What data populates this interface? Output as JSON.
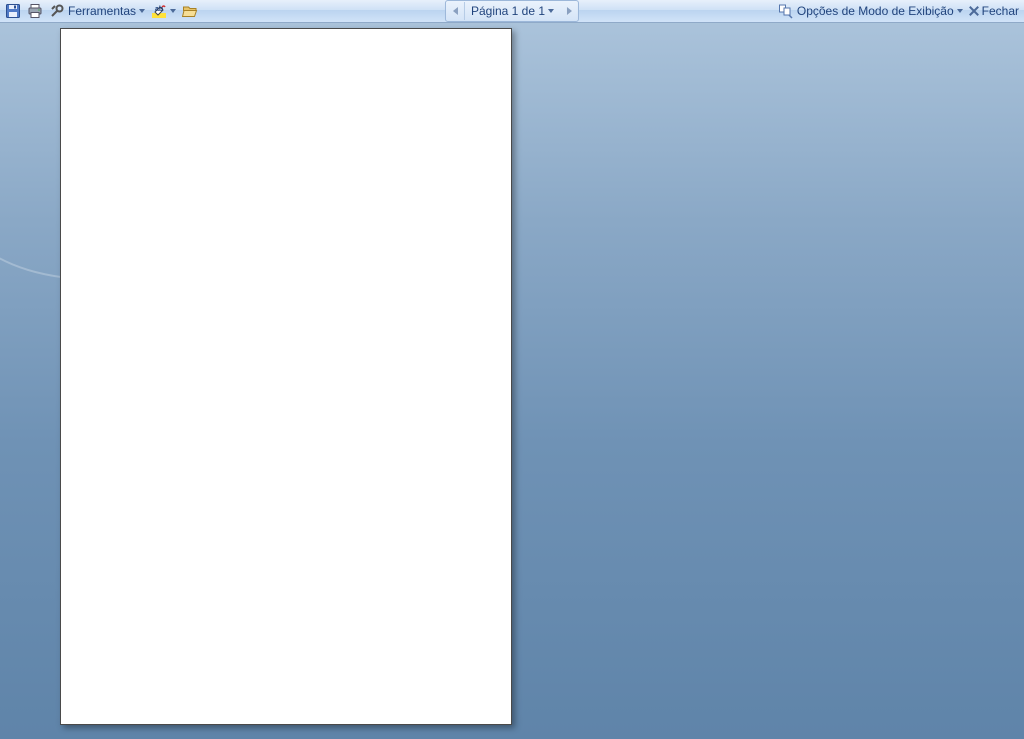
{
  "toolbar": {
    "left": {
      "tools_label": "Ferramentas"
    },
    "center": {
      "page_label": "Página 1 de 1"
    },
    "right": {
      "view_options_label": "Opções de Modo de Exibição",
      "close_label": "Fechar"
    }
  }
}
